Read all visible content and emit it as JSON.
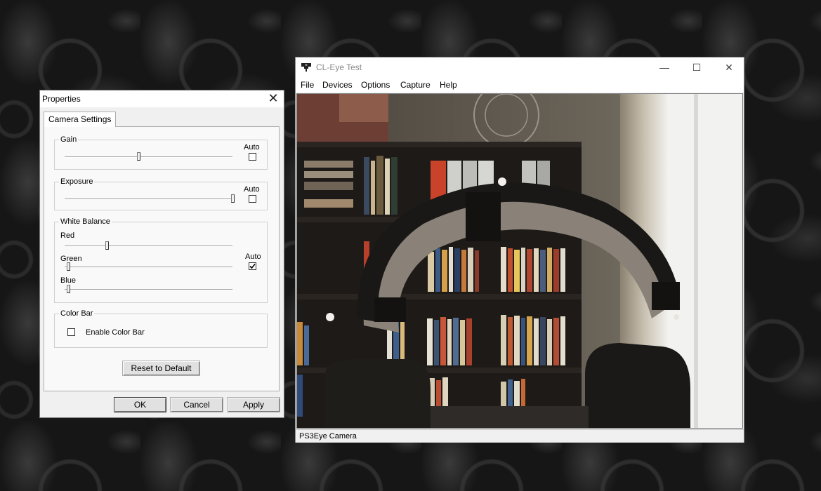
{
  "properties_dialog": {
    "title": "Properties",
    "tab_label": "Camera Settings",
    "gain": {
      "label": "Gain",
      "auto_label": "Auto",
      "auto_checked": false,
      "value_fraction": 0.44
    },
    "exposure": {
      "label": "Exposure",
      "auto_label": "Auto",
      "auto_checked": false,
      "value_fraction": 1.0
    },
    "white_balance": {
      "label": "White Balance",
      "auto_label": "Auto",
      "auto_checked": true,
      "red": {
        "label": "Red",
        "value_fraction": 0.25
      },
      "green": {
        "label": "Green",
        "value_fraction": 0.02
      },
      "blue": {
        "label": "Blue",
        "value_fraction": 0.02
      }
    },
    "color_bar": {
      "label": "Color Bar",
      "enable_label": "Enable Color Bar",
      "checked": false
    },
    "reset_button": "Reset to Default",
    "ok_button": "OK",
    "cancel_button": "Cancel",
    "apply_button": "Apply",
    "close_glyph": "✕"
  },
  "cleye_window": {
    "title": "CL-Eye Test",
    "controls": {
      "minimize": "—",
      "maximize": "☐",
      "close": "✕"
    },
    "menu": [
      "File",
      "Devices",
      "Options",
      "Capture",
      "Help"
    ],
    "status_text": "PS3Eye Camera"
  },
  "icons": [
    "camera-icon",
    "close-icon",
    "minimize-icon",
    "maximize-icon",
    "checkmark-icon"
  ]
}
